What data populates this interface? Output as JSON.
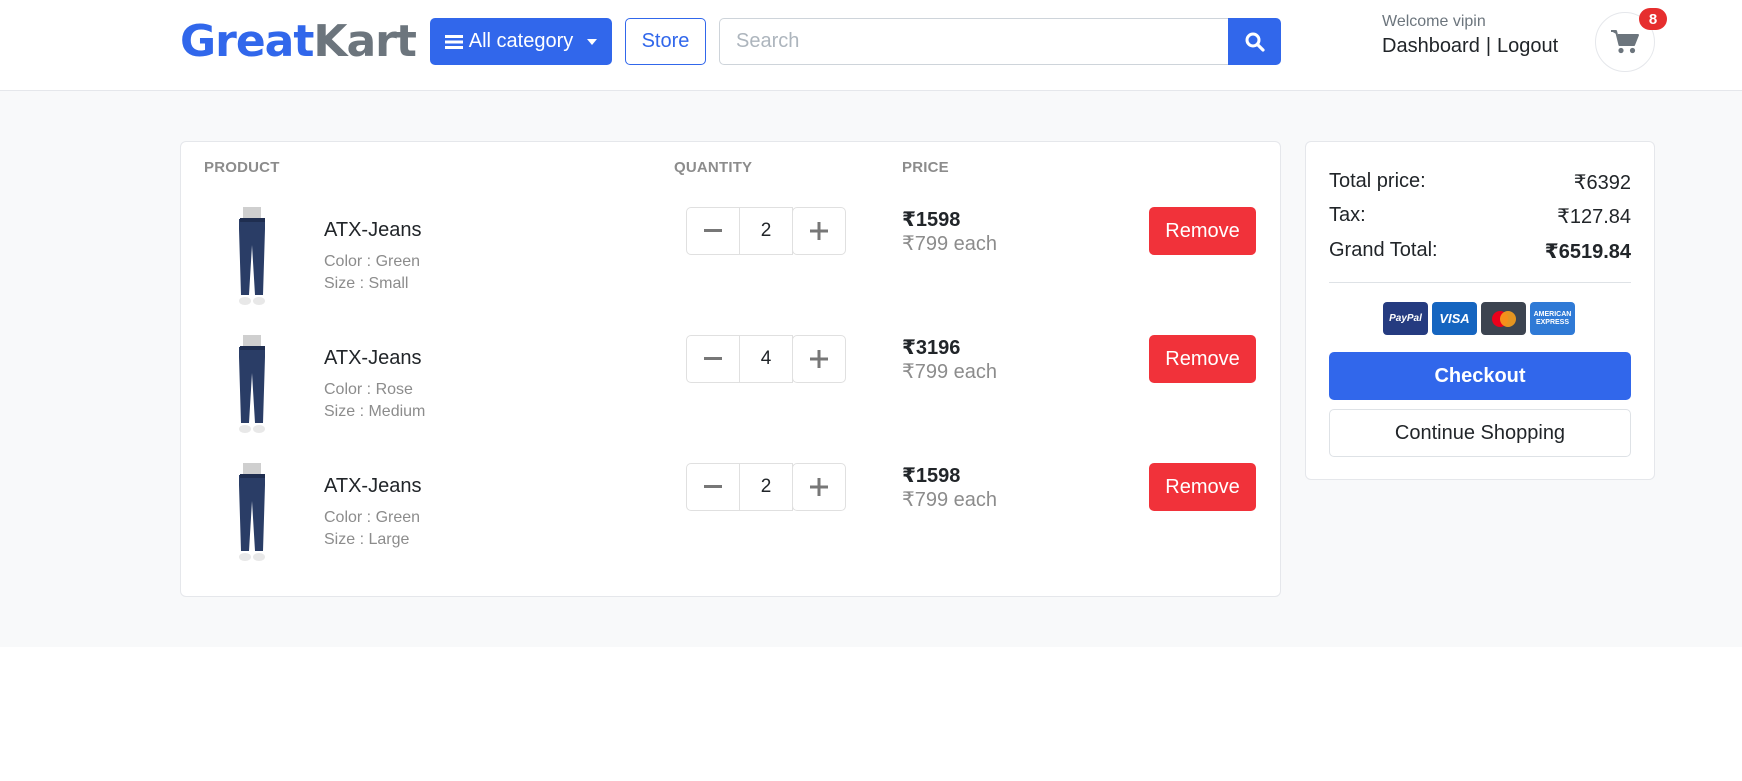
{
  "header": {
    "logo_part1": "Great",
    "logo_part2": "Kart",
    "category_label": "All category",
    "store_label": "Store",
    "search_placeholder": "Search",
    "welcome_text": "Welcome vipin",
    "dashboard_label": "Dashboard",
    "separator": "|",
    "logout_label": "Logout",
    "cart_count": "8"
  },
  "cart": {
    "columns": {
      "product": "PRODUCT",
      "quantity": "QUANTITY",
      "price": "PRICE"
    },
    "items": [
      {
        "name": "ATX-Jeans",
        "color": "Color : Green",
        "size": "Size : Small",
        "quantity": "2",
        "total": "₹1598",
        "each": "₹799 each",
        "remove_label": "Remove"
      },
      {
        "name": "ATX-Jeans",
        "color": "Color : Rose",
        "size": "Size : Medium",
        "quantity": "4",
        "total": "₹3196",
        "each": "₹799 each",
        "remove_label": "Remove"
      },
      {
        "name": "ATX-Jeans",
        "color": "Color : Green",
        "size": "Size : Large",
        "quantity": "2",
        "total": "₹1598",
        "each": "₹799 each",
        "remove_label": "Remove"
      }
    ]
  },
  "summary": {
    "total_label": "Total price:",
    "total_value": "₹6392",
    "tax_label": "Tax:",
    "tax_value": "₹127.84",
    "grand_label": "Grand Total:",
    "grand_value": "₹6519.84",
    "payment_icons": [
      "paypal-icon",
      "visa-icon",
      "mastercard-icon",
      "amex-icon"
    ],
    "paypal_text": "PayPal",
    "visa_text": "VISA",
    "amex_text_1": "AMERICAN",
    "amex_text_2": "EXPRESS",
    "checkout_label": "Checkout",
    "continue_label": "Continue Shopping"
  },
  "colors": {
    "primary": "#3167eb",
    "danger": "#f1323a",
    "muted": "#8c8c8c",
    "logo_secondary": "#6c757d",
    "band_bg": "#f8f9fa"
  }
}
